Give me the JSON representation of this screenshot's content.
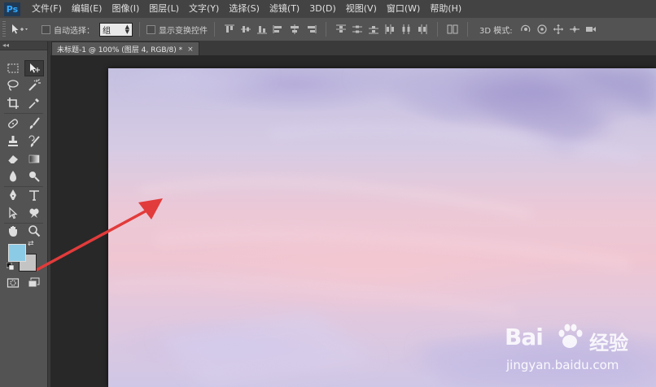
{
  "app": {
    "logo": "Ps"
  },
  "menu": [
    "文件(F)",
    "编辑(E)",
    "图像(I)",
    "图层(L)",
    "文字(Y)",
    "选择(S)",
    "滤镜(T)",
    "3D(D)",
    "视图(V)",
    "窗口(W)",
    "帮助(H)"
  ],
  "options": {
    "auto_select_label": "自动选择：",
    "auto_select_value": "组",
    "show_transform_label": "显示变换控件",
    "mode_3d_label": "3D 模式:"
  },
  "toolbar": {
    "collapse": "◂◂"
  },
  "document": {
    "tab_title": "未标题-1 @ 100% (图层 4, RGB/8) *",
    "close": "×"
  },
  "colors": {
    "foreground": "#8ccbe6",
    "background": "#c4c4c4",
    "annotation_arrow": "#e23b3b"
  },
  "watermark": {
    "brand_a": "Bai",
    "brand_b": "经验",
    "url": "jingyan.baidu.com"
  }
}
